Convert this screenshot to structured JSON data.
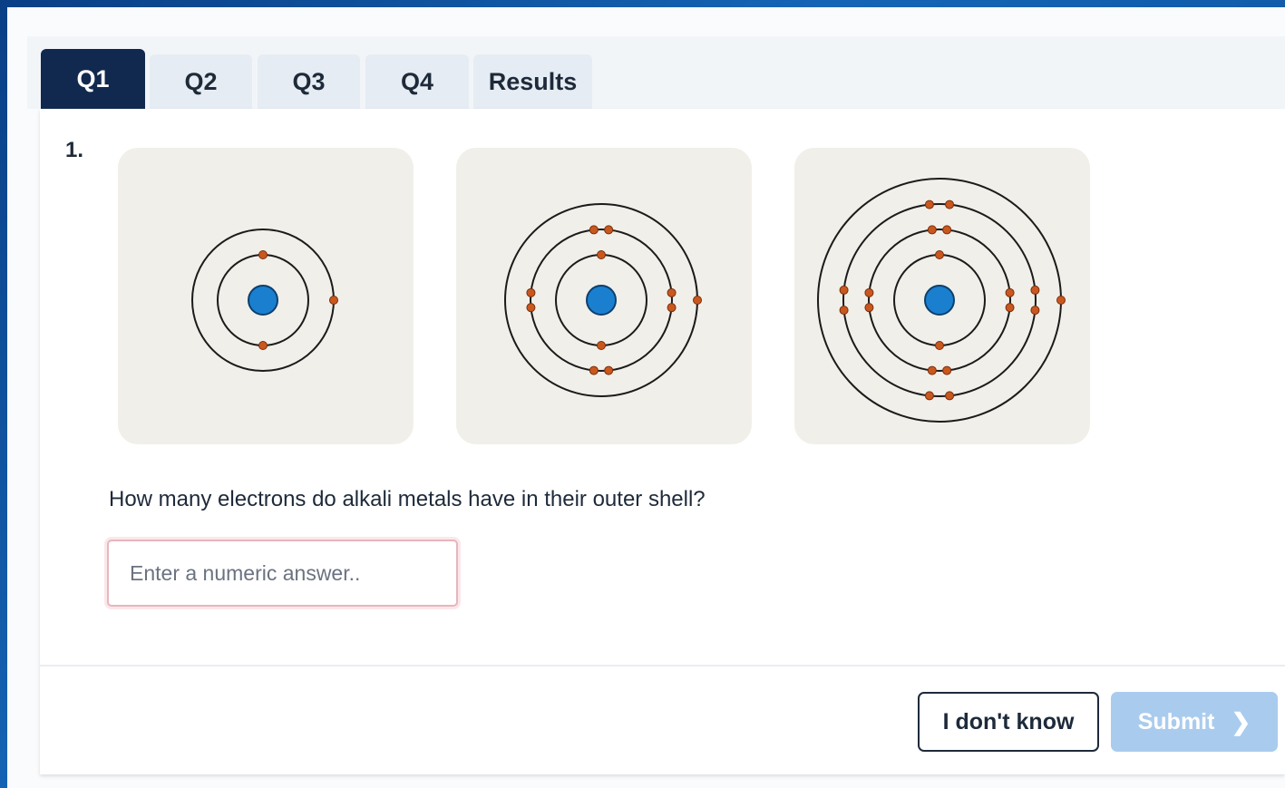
{
  "tabs": [
    {
      "label": "Q1",
      "active": true
    },
    {
      "label": "Q2",
      "active": false
    },
    {
      "label": "Q3",
      "active": false
    },
    {
      "label": "Q4",
      "active": false
    },
    {
      "label": "Results",
      "active": false
    }
  ],
  "question": {
    "number": "1.",
    "text": "How many electrons do alkali metals have in their outer shell?",
    "input_placeholder": "Enter a numeric answer..",
    "input_value": ""
  },
  "diagrams": [
    {
      "shells": [
        2,
        1
      ]
    },
    {
      "shells": [
        2,
        8,
        1
      ]
    },
    {
      "shells": [
        2,
        8,
        8,
        1
      ]
    }
  ],
  "buttons": {
    "dont_know": "I don't know",
    "submit": "Submit",
    "submit_icon": "chevron-right-icon"
  },
  "colors": {
    "nucleus": "#1a7fcf",
    "electron": "#c9581f",
    "active_tab": "#12294f",
    "submit_disabled": "#a9cbee"
  }
}
